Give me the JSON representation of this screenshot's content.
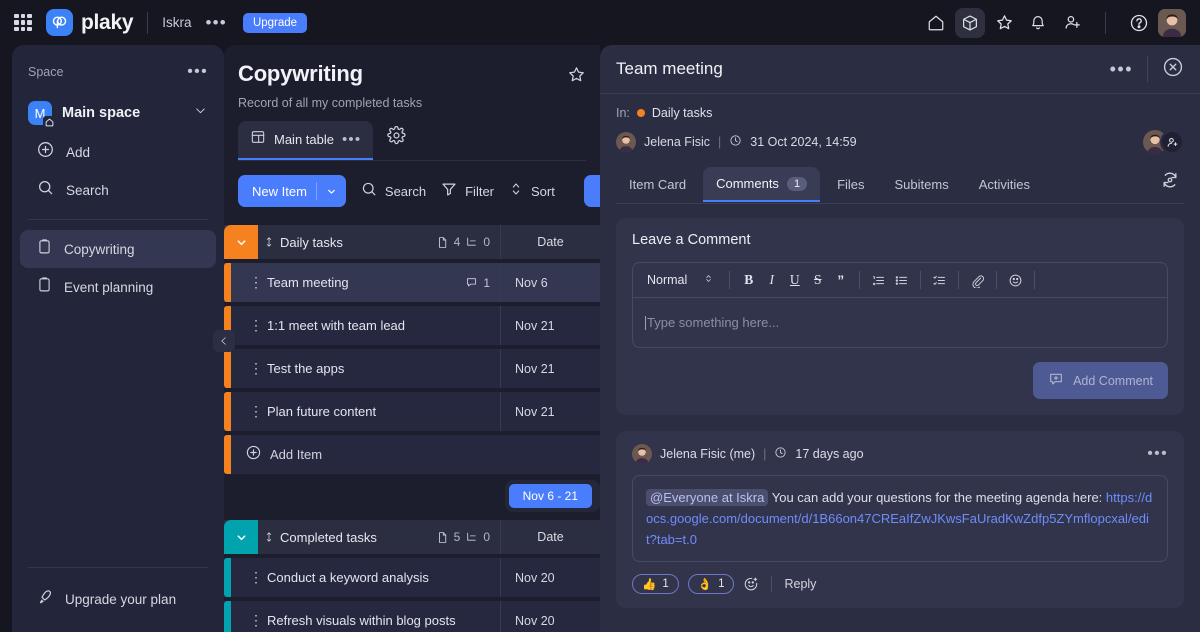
{
  "topbar": {
    "logo_text": "plaky",
    "workspace": "Iskra",
    "more_label": "•••",
    "upgrade_label": "Upgrade",
    "icons": [
      "apps-grid-icon",
      "home-icon",
      "cube-icon",
      "star-icon",
      "bell-icon",
      "add-person-icon",
      "help-icon",
      "avatar"
    ]
  },
  "sidebar": {
    "section_label": "Space",
    "more_label": "•••",
    "space_initial": "M",
    "space_name": "Main space",
    "actions": [
      {
        "label": "Add",
        "icon": "plus-circle-icon"
      },
      {
        "label": "Search",
        "icon": "search-icon"
      }
    ],
    "boards": [
      {
        "label": "Copywriting",
        "icon": "clipboard-icon",
        "selected": true
      },
      {
        "label": "Event planning",
        "icon": "clipboard-icon",
        "selected": false
      }
    ],
    "upgrade_label": "Upgrade your plan"
  },
  "board": {
    "title": "Copywriting",
    "description": "Record of all my completed tasks",
    "view_tab": "Main table",
    "view_tab_dots": "•••",
    "toolbar": {
      "new_item": "New Item",
      "search": "Search",
      "filter": "Filter",
      "sort": "Sort"
    },
    "date_range_badge": "Nov 6 - 21",
    "columns": [
      "Date"
    ],
    "groups": [
      {
        "name": "Daily tasks",
        "color": "#f5821f",
        "doc_count": "4",
        "subitem_count": "0",
        "date_header": "Date",
        "items": [
          {
            "name": "Team meeting",
            "date": "Nov 6",
            "comments": "1",
            "selected": true
          },
          {
            "name": "1:1 meet with team lead",
            "date": "Nov 21",
            "comments": "",
            "selected": false
          },
          {
            "name": "Test the apps",
            "date": "Nov 21",
            "comments": "",
            "selected": false
          },
          {
            "name": "Plan future content",
            "date": "Nov 21",
            "comments": "",
            "selected": false
          }
        ],
        "add_item_label": "Add Item"
      },
      {
        "name": "Completed tasks",
        "color": "#00a3ae",
        "doc_count": "5",
        "subitem_count": "0",
        "date_header": "Date",
        "items": [
          {
            "name": "Conduct a keyword analysis",
            "date": "Nov 20",
            "comments": "",
            "selected": false
          },
          {
            "name": "Refresh visuals within blog posts",
            "date": "Nov 20",
            "comments": "",
            "selected": false
          }
        ],
        "add_item_label": ""
      }
    ]
  },
  "panel": {
    "title": "Team meeting",
    "more_label": "•••",
    "in_label": "In:",
    "group_name": "Daily tasks",
    "group_color": "#f5821f",
    "author": "Jelena Fisic",
    "created_at": "31 Oct 2024, 14:59",
    "tabs": [
      {
        "label": "Item Card",
        "active": false,
        "count": ""
      },
      {
        "label": "Comments",
        "active": true,
        "count": "1"
      },
      {
        "label": "Files",
        "active": false,
        "count": ""
      },
      {
        "label": "Subitems",
        "active": false,
        "count": ""
      },
      {
        "label": "Activities",
        "active": false,
        "count": ""
      }
    ],
    "composer": {
      "heading": "Leave a Comment",
      "format_select": "Normal",
      "toolbar_buttons": [
        "bold-icon",
        "italic-icon",
        "underline-icon",
        "strikethrough-icon",
        "quote-icon",
        "ordered-list-icon",
        "bullet-list-icon",
        "checklist-icon",
        "attachment-icon",
        "emoji-icon"
      ],
      "placeholder": "Type something here...",
      "submit_label": "Add Comment"
    },
    "comments": [
      {
        "author": "Jelena Fisic (me)",
        "time": "17 days ago",
        "more_label": "•••",
        "mention": "@Everyone at Iskra",
        "text": "You can add your questions for the meeting agenda here:",
        "link": "https://docs.google.com/document/d/1B66on47CREaIfZwJKwsFaUradKwZdfp5ZYmflopcxal/edit?tab=t.0",
        "reactions": [
          {
            "emoji": "👍",
            "count": "1"
          },
          {
            "emoji": "👌",
            "count": "1"
          }
        ],
        "reply_label": "Reply"
      }
    ]
  },
  "colors": {
    "accent": "#4a7dfc",
    "orange": "#f5821f",
    "teal": "#00a3ae",
    "panel_bg": "#2b2d42"
  }
}
